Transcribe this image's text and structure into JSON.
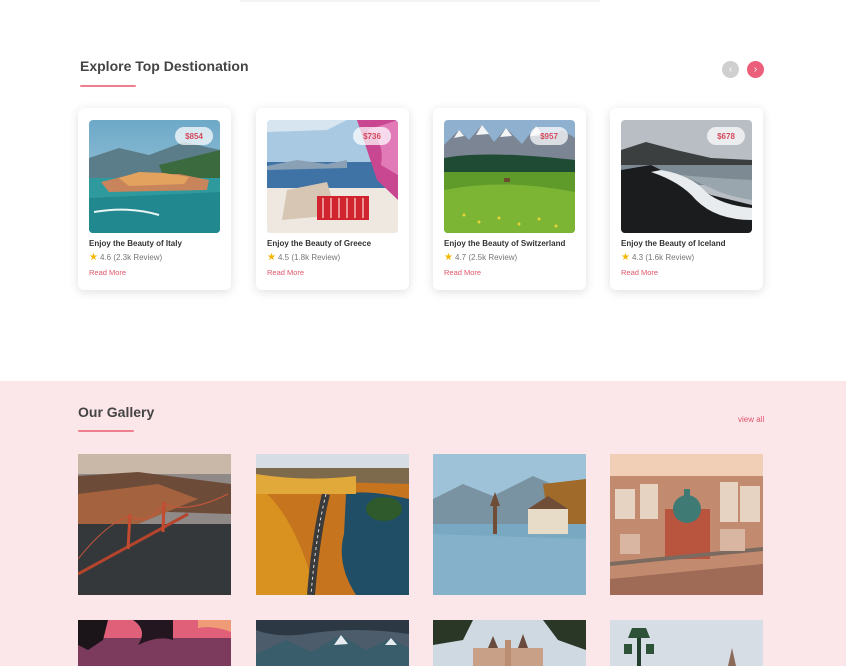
{
  "explore": {
    "title": "Explore Top Destionation",
    "prev_icon": "chevron-left-icon",
    "next_icon": "chevron-right-icon",
    "prev_glyph": "‹",
    "next_glyph": "›",
    "cards": [
      {
        "price": "$854",
        "title": "Enjoy the Beauty of Italy",
        "rating": "4.6 (2.3k Review)",
        "read_more": "Read More"
      },
      {
        "price": "$736",
        "title": "Enjoy the Beauty of Greece",
        "rating": "4.5 (1.8k Review)",
        "read_more": "Read More"
      },
      {
        "price": "$957",
        "title": "Enjoy the Beauty of Switzerland",
        "rating": "4.7 (2.5k Review)",
        "read_more": "Read More"
      },
      {
        "price": "$678",
        "title": "Enjoy the Beauty of Iceland",
        "rating": "4.3 (1.6k Review)",
        "read_more": "Read More"
      }
    ]
  },
  "gallery": {
    "title": "Our Gallery",
    "view_all": "view all"
  },
  "colors": {
    "accent": "#ec5f7a",
    "gallery_bg": "#fbe6e9",
    "star": "#f5b700"
  }
}
